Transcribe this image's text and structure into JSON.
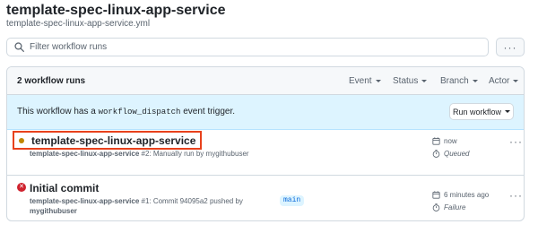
{
  "workflow": {
    "title": "template-spec-linux-app-service",
    "file": "template-spec-linux-app-service.yml"
  },
  "search": {
    "placeholder": "Filter workflow runs",
    "value": ""
  },
  "more_label": "···",
  "runs": {
    "count_label": "2 workflow runs",
    "filters": [
      "Event",
      "Status",
      "Branch",
      "Actor"
    ]
  },
  "banner": {
    "prefix": "This workflow has a ",
    "code": "workflow_dispatch",
    "suffix": " event trigger.",
    "button_label": "Run workflow"
  },
  "run_list": [
    {
      "title": "template-spec-linux-app-service",
      "workflow": "template-spec-linux-app-service",
      "detail": " #2: Manually run by mygithubuser",
      "time": "now",
      "status": "Queued",
      "status_color": "#bf8700"
    },
    {
      "title": "Initial commit",
      "workflow": "template-spec-linux-app-service",
      "detail": " #1: Commit 94095a2 pushed by",
      "actor": "mygithubuser",
      "branch": "main",
      "time": "6 minutes ago",
      "status": "Failure",
      "status_color": "#cf222e"
    }
  ],
  "icons": {
    "search": "search-icon",
    "calendar": "calendar-icon",
    "stopwatch": "stopwatch-icon",
    "kebab": "kebab-horizontal-icon"
  }
}
